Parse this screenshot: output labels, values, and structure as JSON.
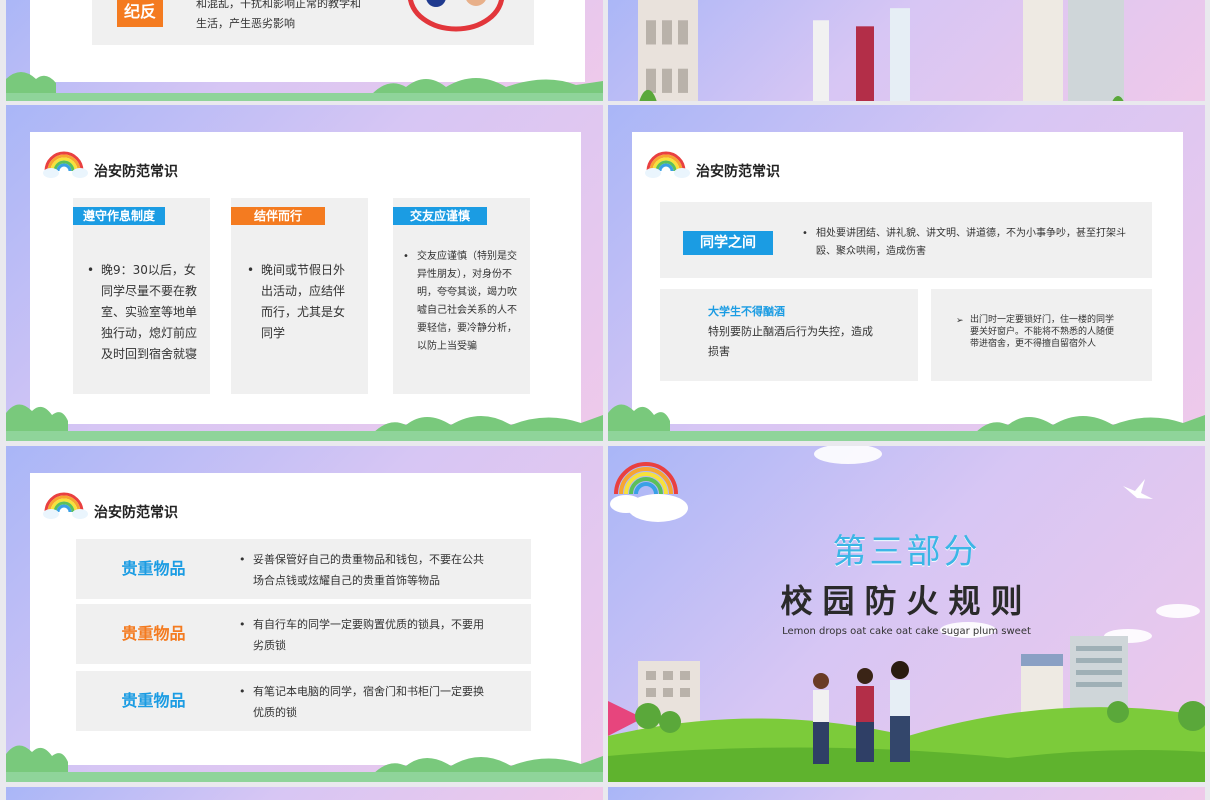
{
  "colors": {
    "orange": "#f47b20",
    "blue": "#1b9ce3",
    "title_blue": "#3cb6e6",
    "panel_gray": "#f0f0f0",
    "grass": "#6bbf3a"
  },
  "slide1": {
    "tag": "纪反",
    "text_lines": [
      "和混乱，干扰和影响正常的教学和",
      "生活，产生恶劣影响"
    ]
  },
  "slide3": {
    "title": "治安防范常识",
    "cards": [
      {
        "tag": "遵守作息制度",
        "text": "晚9：30以后，女同学尽量不要在教室、实验室等地单独行动，熄灯前应及时回到宿舍就寝"
      },
      {
        "tag": "结伴而行",
        "text": "晚间或节假日外出活动，应结伴而行，尤其是女同学"
      },
      {
        "tag": "交友应谨慎",
        "text": "交友应谨慎（特别是交异性朋友），对身份不明，夸夸其谈，竭力吹嘘自己社会关系的人不要轻信，要冷静分析，以防上当受骗"
      }
    ]
  },
  "slide4": {
    "title": "治安防范常识",
    "top_tag": "同学之间",
    "top_text": "相处要讲团结、讲礼貌、讲文明、讲道德，不为小事争吵，甚至打架斗殴、聚众哄闹，造成伤害",
    "left_heading": "大学生不得酗酒",
    "left_text": "特别要防止酗酒后行为失控，造成损害",
    "right_text": "出门时一定要锁好门，住一楼的同学要关好窗户。不能将不熟悉的人随便带进宿舍，更不得擅自留宿外人"
  },
  "slide5": {
    "title": "治安防范常识",
    "rows": [
      {
        "label": "贵重物品",
        "text": "妥善保管好自己的贵重物品和钱包，不要在公共场合点钱或炫耀自己的贵重首饰等物品"
      },
      {
        "label": "贵重物品",
        "text": "有自行车的同学一定要购置优质的锁具，不要用劣质锁"
      },
      {
        "label": "贵重物品",
        "text": "有笔记本电脑的同学，宿舍门和书柜门一定要换优质的锁"
      }
    ]
  },
  "slide6": {
    "section_number": "第三部分",
    "section_title": "校园防火规则",
    "subtitle": "Lemon drops oat cake oat cake sugar plum sweet"
  }
}
